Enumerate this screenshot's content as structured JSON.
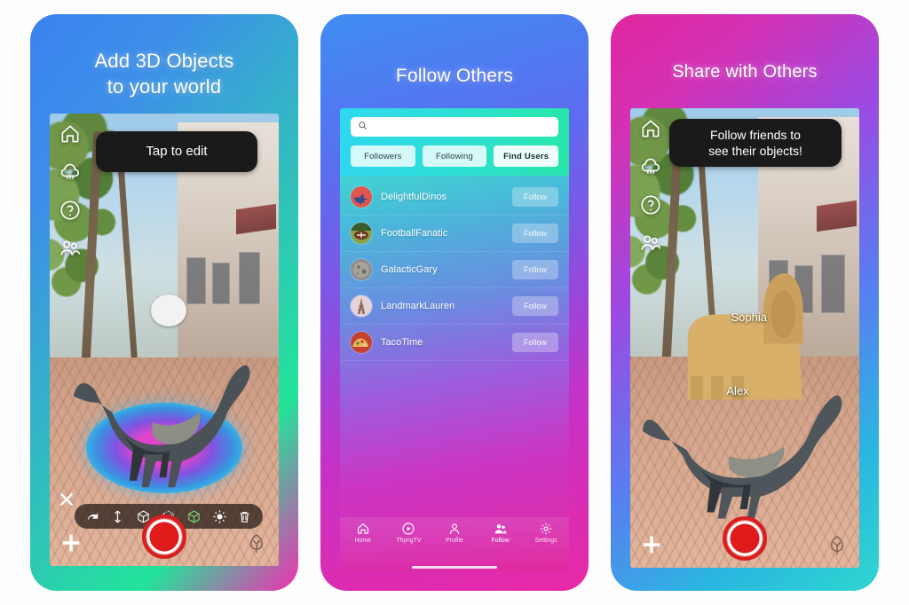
{
  "panels": [
    {
      "title": "Add 3D Objects\nto your world",
      "tooltip": "Tap to edit",
      "ar_icons": [
        "home-icon",
        "cloud-icon",
        "help-icon",
        "people-icon"
      ],
      "edit_tools": [
        "undo-icon",
        "move-vertical-icon",
        "cube-icon",
        "cube-wire-icon",
        "cube-green-icon",
        "brightness-icon",
        "trash-icon"
      ],
      "close_label": "✕",
      "add_label": "+",
      "shutter_label": "record-button",
      "logo_label": "thyng-logo"
    },
    {
      "title": "Follow Others",
      "search": {
        "value": "",
        "placeholder": ""
      },
      "tabs": [
        {
          "label": "Followers",
          "active": false
        },
        {
          "label": "Following",
          "active": false
        },
        {
          "label": "Find Users",
          "active": true
        }
      ],
      "users": [
        {
          "name": "DelightfulDinos",
          "action": "Follow",
          "avatar": "dinosaur-avatar"
        },
        {
          "name": "FootballFanatic",
          "action": "Follow",
          "avatar": "football-avatar"
        },
        {
          "name": "GalacticGary",
          "action": "Follow",
          "avatar": "asteroid-avatar"
        },
        {
          "name": "LandmarkLauren",
          "action": "Follow",
          "avatar": "eiffel-tower-avatar"
        },
        {
          "name": "TacoTime",
          "action": "Follow",
          "avatar": "taco-avatar"
        }
      ],
      "tabbar": [
        {
          "label": "Home",
          "icon": "home-icon",
          "active": false
        },
        {
          "label": "ThyngTV",
          "icon": "play-circle-icon",
          "active": false
        },
        {
          "label": "Profile",
          "icon": "person-icon",
          "active": false
        },
        {
          "label": "Follow",
          "icon": "people-icon",
          "active": true
        },
        {
          "label": "Settings",
          "icon": "gear-icon",
          "active": false
        }
      ]
    },
    {
      "title": "Share with Others",
      "tooltip": "Follow friends to\nsee their objects!",
      "ar_icons": [
        "home-icon",
        "cloud-icon",
        "help-icon",
        "people-icon"
      ],
      "object_labels": [
        "Sophia",
        "Alex"
      ],
      "add_label": "+",
      "shutter_label": "record-button",
      "logo_label": "thyng-logo"
    }
  ],
  "colors": {
    "panel1_gradient_start": "#3a82f0",
    "panel1_gradient_end": "#f22fb1",
    "panel2_gradient_start": "#3f8df2",
    "panel2_gradient_end": "#e92aa6",
    "panel3_gradient_start": "#e0259f",
    "panel3_gradient_end": "#2fd6cf",
    "accent_record": "#e01b1b",
    "tooltip_bg": "#1a1a1a",
    "page_background": "#fdfdfd"
  }
}
